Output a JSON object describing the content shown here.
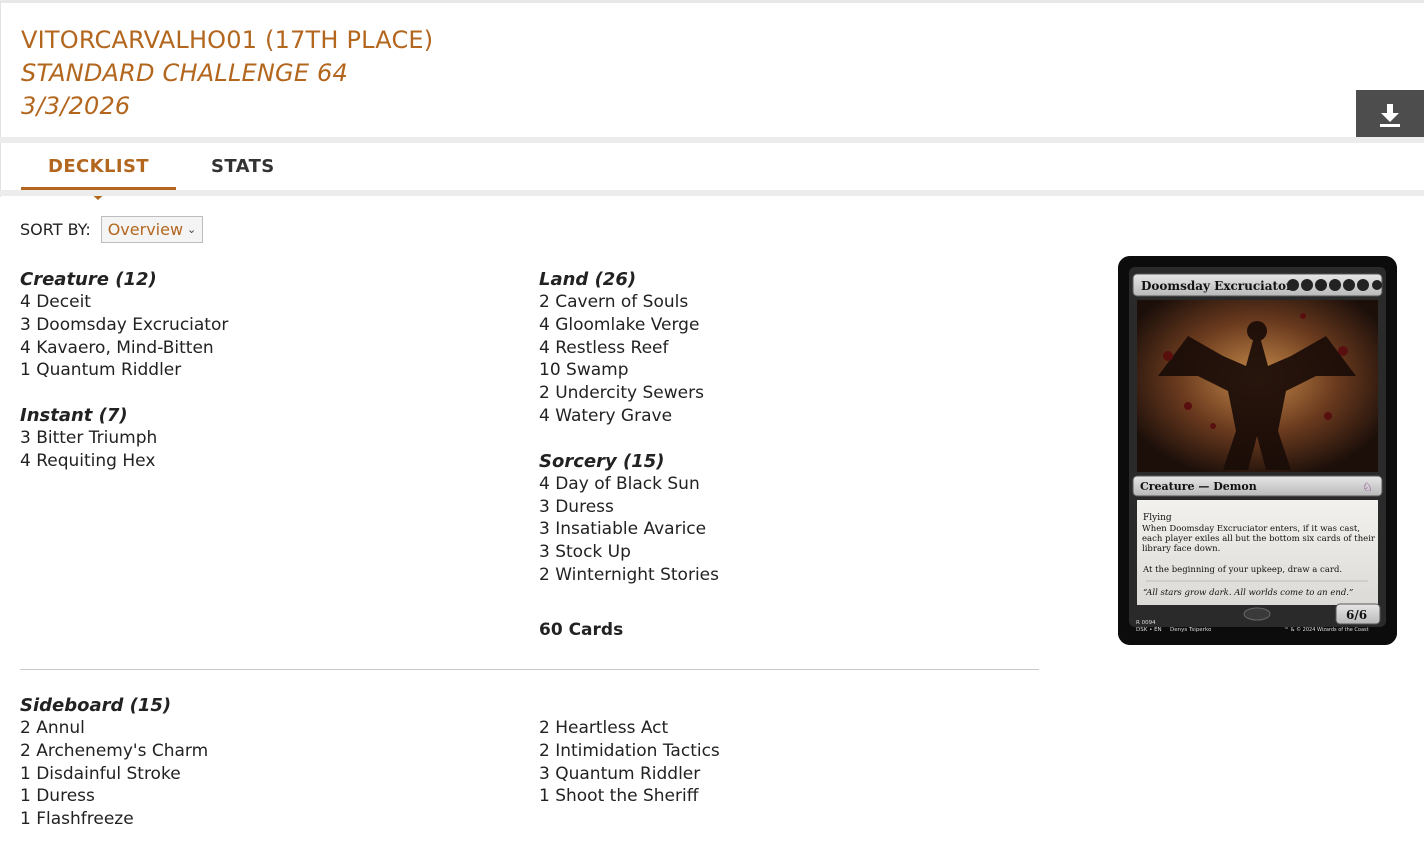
{
  "header": {
    "player": "VITORCARVALHO01 (17TH PLACE)",
    "event": "STANDARD CHALLENGE 64",
    "date": "3/3/2026",
    "download_icon": "download-icon",
    "accent_color": "#b3661e"
  },
  "tabs": [
    {
      "label": "DECKLIST",
      "active": true
    },
    {
      "label": "STATS",
      "active": false
    }
  ],
  "sort": {
    "label": "SORT BY:",
    "selected": "Overview"
  },
  "main": {
    "creature": {
      "heading": "Creature (12)",
      "cards": [
        "4 Deceit",
        "3 Doomsday Excruciator",
        "4 Kavaero, Mind-Bitten",
        "1 Quantum Riddler"
      ]
    },
    "instant": {
      "heading": "Instant (7)",
      "cards": [
        "3 Bitter Triumph",
        "4 Requiting Hex"
      ]
    },
    "land": {
      "heading": "Land (26)",
      "cards": [
        "2 Cavern of Souls",
        "4 Gloomlake Verge",
        "4 Restless Reef",
        "10 Swamp",
        "2 Undercity Sewers",
        "4 Watery Grave"
      ]
    },
    "sorcery": {
      "heading": "Sorcery (15)",
      "cards": [
        "4 Day of Black Sun",
        "3 Duress",
        "3 Insatiable Avarice",
        "3 Stock Up",
        "2 Winternight Stories"
      ]
    },
    "total": "60 Cards"
  },
  "sideboard": {
    "heading": "Sideboard (15)",
    "left": [
      "2 Annul",
      "2 Archenemy's Charm",
      "1 Disdainful Stroke",
      "1 Duress",
      "1 Flashfreeze"
    ],
    "right": [
      "2 Heartless Act",
      "2 Intimidation Tactics",
      "3 Quantum Riddler",
      "1 Shoot the Sheriff"
    ]
  },
  "card_preview": {
    "name": "Doomsday Excruciator",
    "type_line": "Creature — Demon",
    "ability_1": "Flying",
    "ability_2": "When Doomsday Excruciator enters, if it was cast, each player exiles all but the bottom six cards of their library face down.",
    "ability_3": "At the beginning of your upkeep, draw a card.",
    "flavor": "“All stars grow dark. All worlds come to an end.”",
    "pt": "6/6",
    "collector_1": "R 0094",
    "collector_2": "DSK • EN",
    "artist": "Denys Tsiperko",
    "copyright": "™ & © 2024 Wizards of the Coast"
  }
}
